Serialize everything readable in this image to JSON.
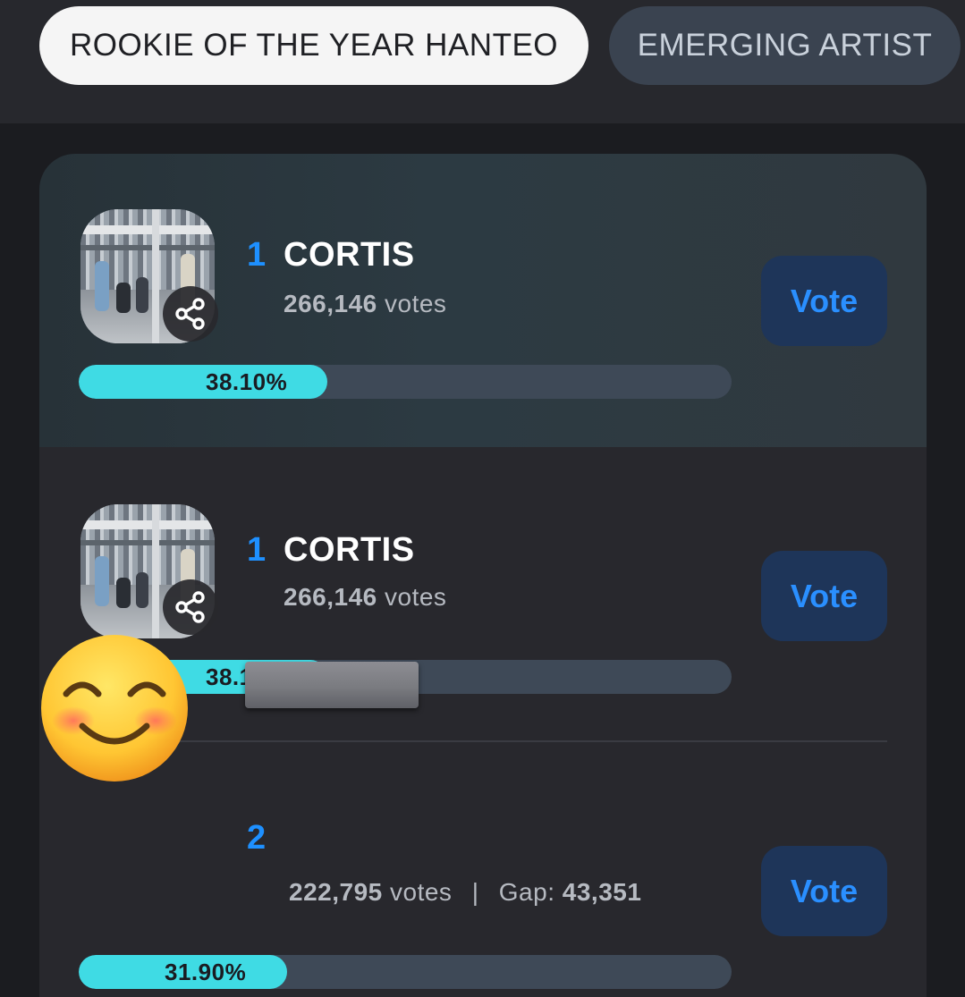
{
  "tabs": [
    {
      "label": "ROOKIE OF THE YEAR HANTEO",
      "active": true
    },
    {
      "label": "EMERGING ARTIST",
      "active": false
    }
  ],
  "entries": [
    {
      "rank": "1",
      "name": "CORTIS",
      "votes_value": "266,146",
      "votes_suffix": "votes",
      "percent_label": "38.10%",
      "percent": 38.1,
      "vote_label": "Vote",
      "avatar": "group-photo",
      "highlighted": true
    },
    {
      "rank": "1",
      "name": "CORTIS",
      "votes_value": "266,146",
      "votes_suffix": "votes",
      "percent_label": "38.10%",
      "percent": 38.1,
      "vote_label": "Vote",
      "avatar": "group-photo",
      "highlighted": false
    },
    {
      "rank": "2",
      "name_hidden": true,
      "votes_value": "222,795",
      "votes_suffix": "votes",
      "gap_label": "Gap:",
      "gap_value": "43,351",
      "percent_label": "31.90%",
      "percent": 31.9,
      "vote_label": "Vote",
      "avatar": "smiling-face-emoji",
      "highlighted": false
    }
  ],
  "colors": {
    "accent": "#1e90ff",
    "bar_fill": "#3fdbe4",
    "vote_button_bg": "#1e3559"
  },
  "icons": [
    "share-icon",
    "smiling-face-emoji"
  ]
}
